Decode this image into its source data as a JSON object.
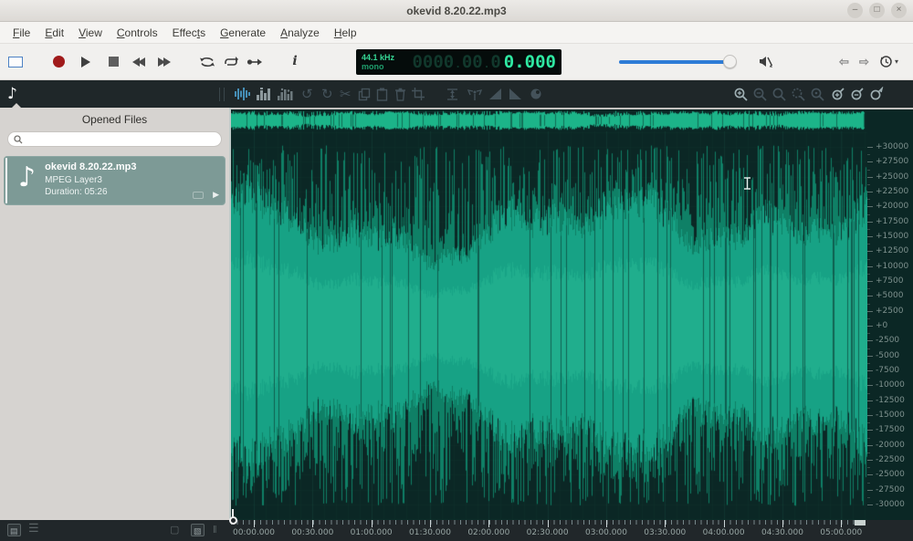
{
  "window": {
    "title": "okevid 8.20.22.mp3"
  },
  "titlebar_controls": {
    "minimize": "–",
    "maximize": "□",
    "close": "×"
  },
  "menu": {
    "items": [
      {
        "label": "File",
        "m": 0
      },
      {
        "label": "Edit",
        "m": 0
      },
      {
        "label": "View",
        "m": 0
      },
      {
        "label": "Controls",
        "m": 0
      },
      {
        "label": "Effects",
        "m": 5
      },
      {
        "label": "Generate",
        "m": 0
      },
      {
        "label": "Analyze",
        "m": 0
      },
      {
        "label": "Help",
        "m": 0
      }
    ]
  },
  "transport": {
    "info_glyph": "i"
  },
  "display": {
    "sample_rate": "44.1 kHz",
    "channel_mode": "mono",
    "ghost_groups": [
      "0000",
      "00",
      "0"
    ],
    "time_value": "0.000"
  },
  "volume": {
    "value_percent": 100
  },
  "sidebar": {
    "panel_title": "Opened Files",
    "search_placeholder": "",
    "file": {
      "name": "okevid 8.20.22.mp3",
      "format": "MPEG Layer3",
      "duration": "Duration: 05:26"
    }
  },
  "amplitude_ruler": {
    "labels": [
      "+30000",
      "+27500",
      "+25000",
      "+22500",
      "+20000",
      "+17500",
      "+15000",
      "+12500",
      "+10000",
      "+7500",
      "+5000",
      "+2500",
      "+0",
      "-2500",
      "-5000",
      "-7500",
      "-10000",
      "-12500",
      "-15000",
      "-17500",
      "-20000",
      "-22500",
      "-25000",
      "-27500",
      "-30000"
    ]
  },
  "timeline": {
    "labels": [
      "00:00.000",
      "00:30.000",
      "01:00.000",
      "01:30.000",
      "02:00.000",
      "02:30.000",
      "03:00.000",
      "03:30.000",
      "04:00.000",
      "04:30.000",
      "05:00.000"
    ]
  },
  "waveform": {
    "seed": 20220820,
    "background": "#0b2725",
    "grid_color": "rgba(20,62,55,0.55)",
    "grid_minor": "rgba(16,50,45,0.45)",
    "core_color": "#17a285",
    "inner_color": "#20ae8d",
    "spike_color": "#0f8066",
    "overview_color": "#1cb489",
    "dark_streak": "rgba(8,38,34,0.55)"
  },
  "colors": {
    "accent_blue": "#2e7cd6",
    "record_red": "#a01a1a",
    "display_green": "#2fe8a2",
    "card_bg": "#7d9a96"
  }
}
